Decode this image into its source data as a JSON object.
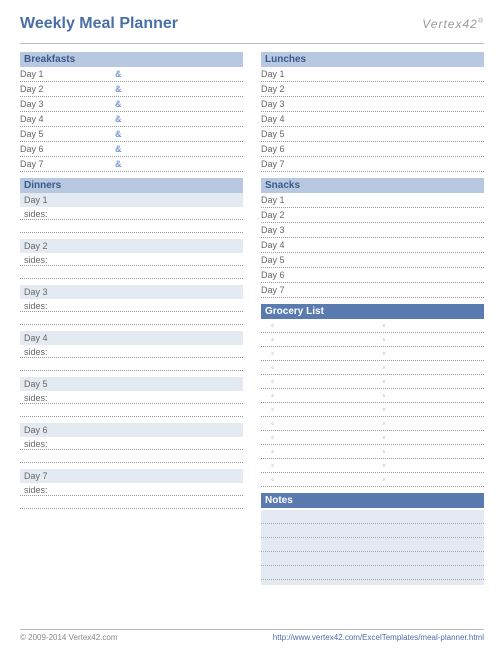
{
  "title": "Weekly Meal Planner",
  "logo": "Vertex42",
  "sections": {
    "breakfasts": {
      "head": "Breakfasts",
      "days": [
        "Day 1",
        "Day 2",
        "Day 3",
        "Day 4",
        "Day 5",
        "Day 6",
        "Day 7"
      ],
      "sep": "&"
    },
    "lunches": {
      "head": "Lunches",
      "days": [
        "Day 1",
        "Day 2",
        "Day 3",
        "Day 4",
        "Day 5",
        "Day 6",
        "Day 7"
      ]
    },
    "dinners": {
      "head": "Dinners",
      "days": [
        "Day 1",
        "Day 2",
        "Day 3",
        "Day 4",
        "Day 5",
        "Day 6",
        "Day 7"
      ],
      "sides": "sides:"
    },
    "snacks": {
      "head": "Snacks",
      "days": [
        "Day 1",
        "Day 2",
        "Day 3",
        "Day 4",
        "Day 5",
        "Day 6",
        "Day 7"
      ]
    },
    "grocery": {
      "head": "Grocery List",
      "rows": 12,
      "cols": 2,
      "bullet": "◦"
    },
    "notes": {
      "head": "Notes",
      "lines": 5
    }
  },
  "footer": {
    "copyright": "© 2009-2014 Vertex42.com",
    "link": "http://www.vertex42.com/ExcelTemplates/meal-planner.html"
  }
}
